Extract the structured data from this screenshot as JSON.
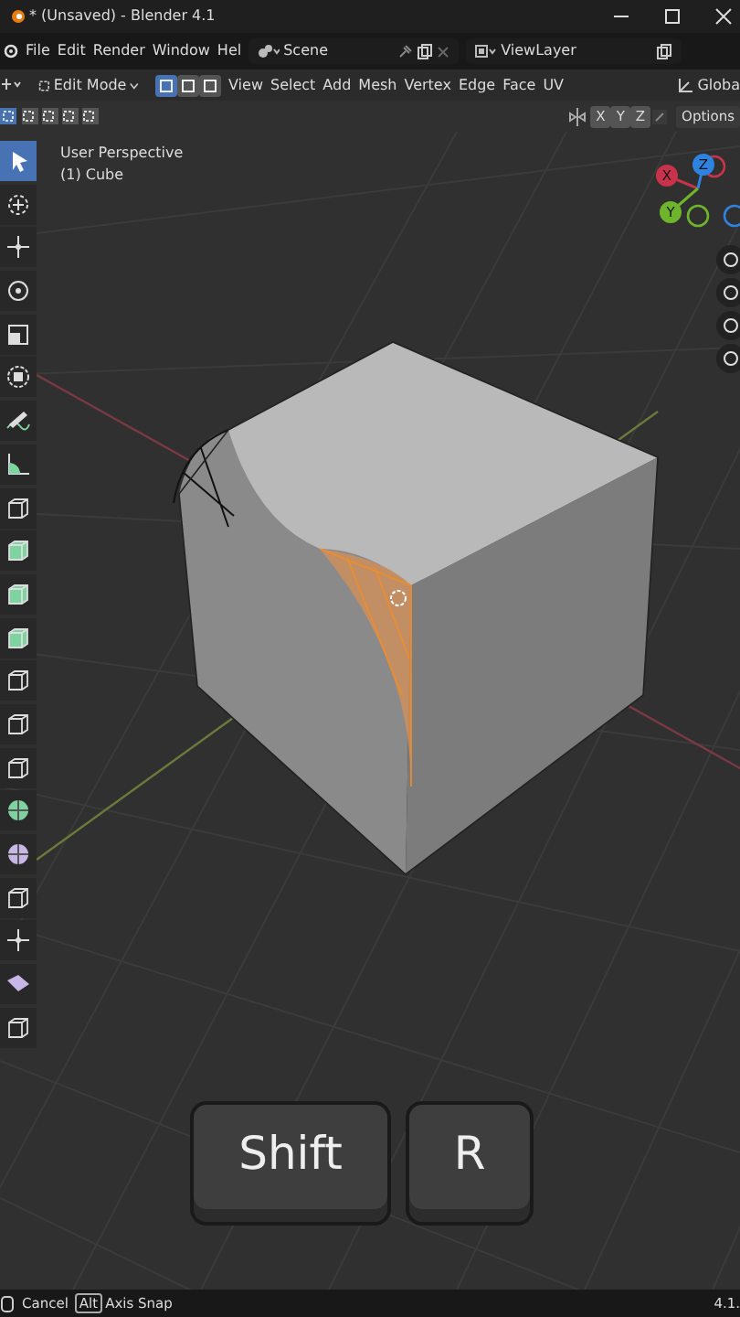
{
  "window": {
    "title": "* (Unsaved) - Blender 4.1"
  },
  "menu": [
    "File",
    "Edit",
    "Render",
    "Window",
    "Hel"
  ],
  "scene": "Scene",
  "view_layer": "ViewLayer",
  "header": {
    "mode": "Edit Mode",
    "select_modes": [
      {
        "selected": true
      },
      {
        "selected": false
      },
      {
        "selected": false
      }
    ],
    "menus": [
      "View",
      "Select",
      "Add",
      "Mesh",
      "Vertex",
      "Edge",
      "Face",
      "UV"
    ],
    "orientation": "Globa"
  },
  "tool_header": {
    "axes": [
      "X",
      "Y",
      "Z"
    ],
    "options": "Options"
  },
  "viewport": {
    "view_name": "User Perspective",
    "object": "(1) Cube"
  },
  "gizmo": {
    "axes": [
      {
        "label": "X",
        "color": "#c8324b"
      },
      {
        "label": "Y",
        "color": "#6fb52c"
      },
      {
        "label": "Z",
        "color": "#2f83e0"
      }
    ]
  },
  "toolbar": [
    {
      "selected": true
    },
    {
      "selected": false
    },
    {
      "selected": false
    },
    {
      "selected": false
    },
    {
      "selected": false
    },
    {
      "selected": false
    },
    {
      "selected": false
    },
    {
      "selected": false
    },
    {
      "selected": false
    },
    {
      "selected": false
    },
    {
      "selected": false
    },
    {
      "selected": false
    },
    {
      "selected": false
    },
    {
      "selected": false
    },
    {
      "selected": false
    },
    {
      "selected": false
    },
    {
      "selected": false
    },
    {
      "selected": false
    },
    {
      "selected": false
    },
    {
      "selected": false
    },
    {
      "selected": false
    }
  ],
  "keys": [
    "Shift",
    "R"
  ],
  "status": {
    "cancel": "Cancel",
    "key": "Alt",
    "action": "Axis Snap",
    "version": "4.1."
  }
}
